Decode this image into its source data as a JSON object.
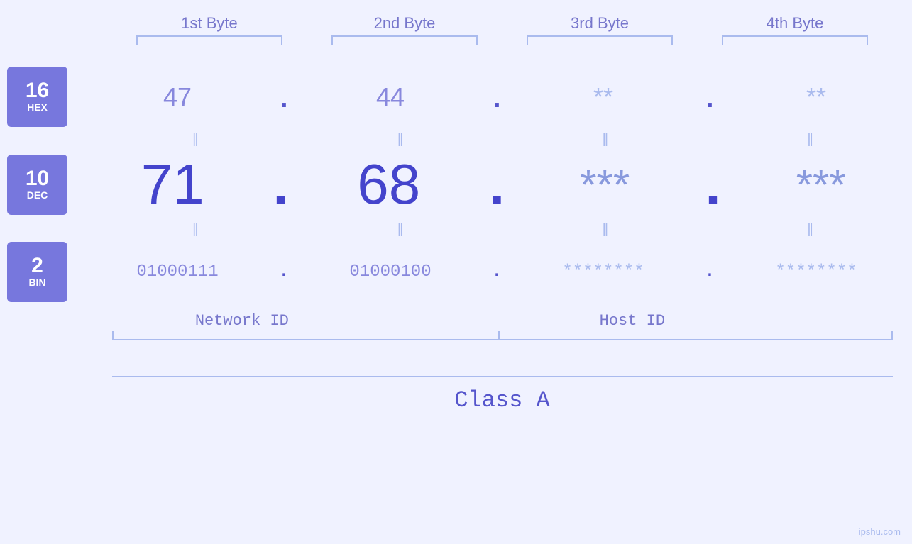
{
  "byteLabels": [
    "1st Byte",
    "2nd Byte",
    "3rd Byte",
    "4th Byte"
  ],
  "hexRow": {
    "badge": {
      "num": "16",
      "label": "HEX"
    },
    "values": [
      "47",
      "44",
      "**",
      "**"
    ]
  },
  "decRow": {
    "badge": {
      "num": "10",
      "label": "DEC"
    },
    "values": [
      "71",
      "68",
      "***",
      "***"
    ]
  },
  "binRow": {
    "badge": {
      "num": "2",
      "label": "BIN"
    },
    "values": [
      "01000111",
      "01000100",
      "********",
      "********"
    ]
  },
  "networkId": "Network ID",
  "hostId": "Host ID",
  "classLabel": "Class A",
  "watermark": "ipshu.com",
  "equalsSymbol": "||"
}
